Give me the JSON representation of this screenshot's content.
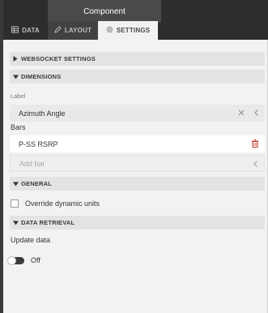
{
  "header": {
    "title": "Component"
  },
  "tabs": [
    {
      "label": "DATA"
    },
    {
      "label": "LAYOUT"
    },
    {
      "label": "SETTINGS"
    }
  ],
  "sections": {
    "websocket": {
      "label": "WEBSOCKET SETTINGS",
      "expanded": false
    },
    "dimensions": {
      "label": "DIMENSIONS",
      "expanded": true
    },
    "general": {
      "label": "GENERAL",
      "expanded": true
    },
    "data_retrieval": {
      "label": "DATA RETRIEVAL",
      "expanded": true
    }
  },
  "dimensions": {
    "label_caption": "Label",
    "label_value": "Azimuth Angle",
    "bars_caption": "Bars",
    "bars": [
      {
        "name": "P-SS RSRP"
      }
    ],
    "add_bar_placeholder": "Add bar"
  },
  "general": {
    "override_units_label": "Override dynamic units",
    "override_units_checked": false
  },
  "data_retrieval": {
    "update_caption": "Update data",
    "toggle_state": "Off",
    "toggle_on": false
  },
  "colors": {
    "header_bg": "#2d2d2d",
    "active_tab_bg": "#f2f2f2",
    "section_bar_bg": "#e3e3e3",
    "delete_icon": "#c0392b"
  }
}
